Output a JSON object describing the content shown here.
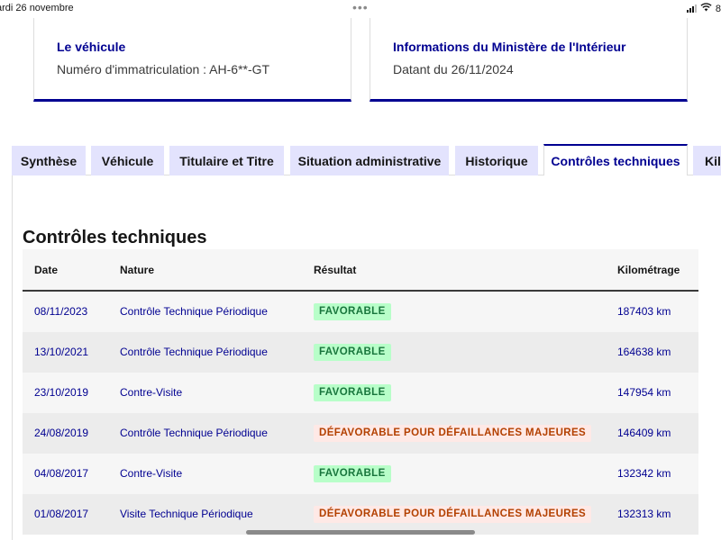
{
  "status_bar": {
    "date": "ardi 26 novembre",
    "dots": "•••",
    "battery": "8"
  },
  "cards": [
    {
      "title": "Le véhicule",
      "text": "Numéro d'immatriculation : AH-6**-GT"
    },
    {
      "title": "Informations du Ministère de l'Intérieur",
      "text": "Datant du 26/11/2024"
    }
  ],
  "tabs": [
    {
      "label": "Synthèse"
    },
    {
      "label": "Véhicule"
    },
    {
      "label": "Titulaire et Titre"
    },
    {
      "label": "Situation administrative"
    },
    {
      "label": "Historique"
    },
    {
      "label": "Contrôles techniques",
      "active": true
    },
    {
      "label": "Kilo"
    }
  ],
  "section": {
    "title": "Contrôles techniques"
  },
  "table": {
    "headers": {
      "date": "Date",
      "nature": "Nature",
      "result": "Résultat",
      "km": "Kilométrage"
    },
    "rows": [
      {
        "date": "08/11/2023",
        "nature": "Contrôle Technique Périodique",
        "result": "FAVORABLE",
        "status": "ok",
        "km": "187403 km"
      },
      {
        "date": "13/10/2021",
        "nature": "Contrôle Technique Périodique",
        "result": "FAVORABLE",
        "status": "ok",
        "km": "164638 km"
      },
      {
        "date": "23/10/2019",
        "nature": "Contre-Visite",
        "result": "FAVORABLE",
        "status": "ok",
        "km": "147954 km"
      },
      {
        "date": "24/08/2019",
        "nature": "Contrôle Technique Périodique",
        "result": "DÉFAVORABLE POUR DÉFAILLANCES MAJEURES",
        "status": "ko",
        "km": "146409 km"
      },
      {
        "date": "04/08/2017",
        "nature": "Contre-Visite",
        "result": "FAVORABLE",
        "status": "ok",
        "km": "132342 km"
      },
      {
        "date": "01/08/2017",
        "nature": "Visite Technique Périodique",
        "result": "DÉFAVORABLE POUR DÉFAILLANCES MAJEURES",
        "status": "ko",
        "km": "132313 km"
      }
    ]
  },
  "colors": {
    "accent": "#000091",
    "tab_bg": "#e3e3fd",
    "success_bg": "#b8fec9",
    "success_text": "#18753c",
    "error_bg": "#fee9e6",
    "error_text": "#b34000"
  },
  "icons": {
    "wifi": "wifi-icon",
    "signal": "signal-icon",
    "battery": "battery-icon"
  }
}
